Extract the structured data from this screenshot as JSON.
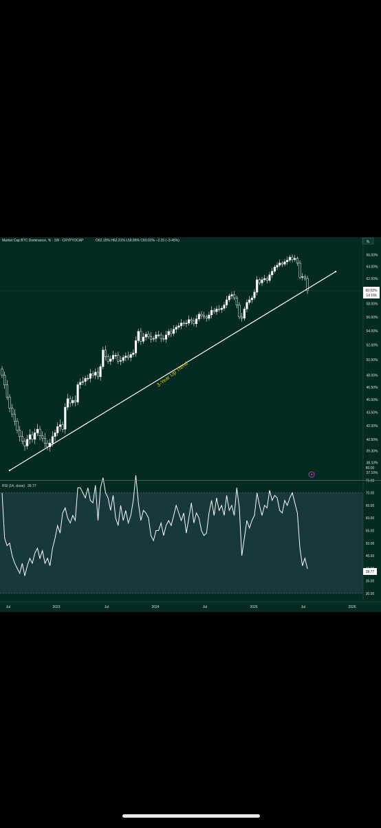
{
  "header": {
    "title": "Market Cap BTC Dominance, % · 1W · CRYPTOCAP",
    "ohlc": "O62.15% H62.21% L59.96% C60.02% −2.15 (−3.45%)",
    "pct_button": "%"
  },
  "price_axis": {
    "ticks": [
      "66.00%",
      "64.00%",
      "62.00%",
      "60.02%",
      "58.00%",
      "56.00%",
      "54.00%",
      "52.00%",
      "50.00%",
      "48.00%",
      "46.50%",
      "45.00%",
      "43.50%",
      "42.00%",
      "40.50%",
      "39.30%",
      "38.10%",
      "37.10%"
    ],
    "last_price_label": "60.02%",
    "countdown_label": "1d 16h"
  },
  "annotation": {
    "trendline_label": "3-Year Up Trend"
  },
  "rsi": {
    "title": "RSI (14, close)",
    "value_label": "39.77",
    "ticks": [
      "80.00",
      "75.00",
      "70.00",
      "65.00",
      "60.00",
      "55.00",
      "50.00",
      "45.00",
      "40.00",
      "35.00",
      "30.00"
    ],
    "last_value_label": "39.77"
  },
  "time_axis": {
    "labels": [
      "Jul",
      "2023",
      "Jul",
      "2024",
      "Jul",
      "2025",
      "Jul",
      "2026"
    ]
  },
  "colors": {
    "background": "#042a22",
    "grid": "#1f4a40",
    "candle": "#ffffff",
    "trendline": "#ffffff",
    "annotation": "#e6c21a",
    "rsi_band": "#17383c",
    "rsi_line": "#ffffff",
    "axis_text": "#d8e2df",
    "icon_accent": "#c0399a"
  },
  "chart_data": [
    {
      "type": "candlestick",
      "title": "Market Cap BTC Dominance, % · 1W · CRYPTOCAP",
      "scale": "log",
      "ylim": [
        37.0,
        67.0
      ],
      "last_value": 60.02,
      "trendline": {
        "label": "3-Year Up Trend",
        "points": [
          [
            "2022-07",
            37.1
          ],
          [
            "2025-09",
            61.2
          ]
        ]
      },
      "series": [
        {
          "close": [
            48.0,
            46.8,
            45.3,
            44.0,
            43.3,
            42.5,
            41.5,
            40.8,
            40.3,
            39.8,
            40.5,
            41.0,
            40.5,
            41.2,
            41.6,
            40.9,
            40.6,
            40.1,
            39.7,
            40.1,
            40.8,
            41.2,
            41.9,
            42.1,
            41.6,
            44.1,
            45.1,
            44.6,
            44.9,
            44.7,
            46.8,
            47.1,
            47.2,
            47.6,
            47.6,
            48.2,
            48.0,
            48.4,
            47.8,
            49.1,
            51.3,
            50.4,
            49.8,
            50.1,
            50.6,
            50.6,
            49.8,
            49.9,
            50.3,
            50.5,
            50.3,
            50.7,
            50.9,
            52.6,
            53.9,
            52.5,
            53.1,
            53.5,
            53.2,
            52.8,
            52.9,
            53.4,
            53.4,
            52.9,
            52.8,
            53.4,
            53.9,
            53.6,
            54.2,
            54.5,
            54.7,
            55.1,
            55.0,
            55.1,
            55.6,
            55.4,
            55.0,
            55.7,
            56.4,
            56.2,
            56.0,
            55.8,
            56.3,
            57.0,
            56.8,
            57.2,
            57.1,
            57.3,
            57.8,
            58.6,
            59.2,
            59.4,
            58.9,
            57.8,
            56.0,
            55.8,
            57.2,
            58.2,
            58.6,
            58.9,
            59.8,
            61.8,
            61.3,
            61.8,
            62.0,
            61.7,
            62.6,
            63.2,
            63.9,
            64.2,
            64.6,
            64.4,
            64.8,
            65.1,
            65.6,
            65.2,
            65.4,
            64.6,
            62.2,
            62.3,
            62.0,
            60.02
          ]
        }
      ]
    },
    {
      "type": "line",
      "title": "RSI (14, close)",
      "ylim": [
        30,
        80
      ],
      "bands": [
        30,
        70
      ],
      "last_value": 39.77,
      "series": [
        {
          "values": [
            70,
            52,
            49,
            50,
            45,
            42,
            40,
            38,
            42,
            37,
            41,
            44,
            42,
            46,
            48,
            44,
            47,
            42,
            44,
            41,
            48,
            52,
            57,
            54,
            62,
            64,
            60,
            58,
            61,
            59,
            72,
            72,
            70,
            68,
            72,
            67,
            66,
            73,
            59,
            72,
            76,
            70,
            68,
            63,
            69,
            60,
            57,
            65,
            59,
            63,
            58,
            61,
            67,
            77,
            66,
            59,
            63,
            62,
            60,
            53,
            51,
            55,
            55,
            58,
            53,
            57,
            59,
            57,
            61,
            65,
            62,
            59,
            62,
            54,
            60,
            66,
            58,
            62,
            60,
            55,
            53,
            54,
            62,
            67,
            61,
            68,
            63,
            65,
            61,
            69,
            63,
            65,
            61,
            72,
            64,
            45,
            52,
            59,
            56,
            59,
            61,
            70,
            65,
            61,
            65,
            64,
            71,
            67,
            69,
            68,
            63,
            62,
            67,
            65,
            68,
            70,
            66,
            62,
            48,
            41,
            44,
            39.77
          ]
        }
      ]
    }
  ]
}
